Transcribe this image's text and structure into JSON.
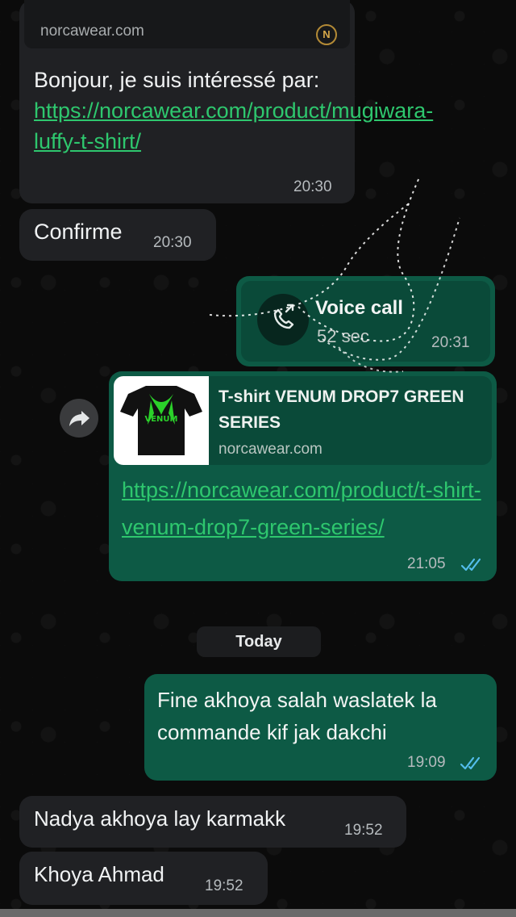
{
  "messages": [
    {
      "id": "b1",
      "direction": "incoming",
      "preview_domain": "norcawear.com",
      "text_prefix": "Bonjour, je suis intéressé par: ",
      "link": "https://norcawear.com/product/mugiwara-luffy-t-shirt/",
      "time": "20:30"
    },
    {
      "id": "b2",
      "direction": "incoming",
      "text": "Confirme",
      "time": "20:30"
    },
    {
      "id": "b3",
      "direction": "outgoing",
      "type": "voice-call",
      "title": "Voice call",
      "duration": "52 sec",
      "time": "20:31",
      "icon": "outgoing-call-icon"
    },
    {
      "id": "b4",
      "direction": "outgoing",
      "type": "link-preview",
      "preview_title": "T-shirt VENUM DROP7 GREEN SERIES",
      "preview_domain": "norcawear.com",
      "thumb_text": "VENUM",
      "link": "https://norcawear.com/product/t-shirt-venum-drop7-green-series/",
      "time": "21:05",
      "status": "read",
      "status_color": "#53bdeb"
    },
    {
      "id": "b5",
      "direction": "outgoing",
      "text": "Fine akhoya salah waslatek la commande kif jak dakchi",
      "time": "19:09",
      "status": "read"
    },
    {
      "id": "b6",
      "direction": "incoming",
      "text": "Nadya akhoya lay karmakk",
      "time": "19:52"
    },
    {
      "id": "b7",
      "direction": "incoming",
      "text": "Khoya Ahmad",
      "time": "19:52"
    }
  ],
  "date_separator": "Today",
  "forward_icon": "forward-arrow-icon",
  "colors": {
    "incoming_bubble": "#202124",
    "outgoing_bubble": "#0d5a45",
    "link_incoming": "#2ec76e",
    "link_outgoing": "#5ee28f",
    "read_ticks": "#53bdeb",
    "background": "#0b0b0b"
  }
}
